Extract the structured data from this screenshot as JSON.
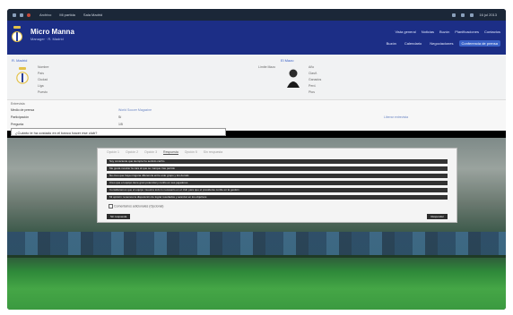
{
  "topbar": {
    "menu": [
      "Archivo",
      "Mi partida",
      "Sala Madrid"
    ],
    "date": "16 jul 2013"
  },
  "header": {
    "club_name": "Micro Manna",
    "club_sub": "Manager · R. Madrid",
    "tabs_row1": [
      "Vista general",
      "Noticias",
      "Buzón",
      "Planificaciones",
      "Contactos"
    ],
    "tabs_row2": [
      "Buzón",
      "Calendario",
      "Negociaciones",
      "Conferencia de prensa"
    ],
    "active_tab": "Conferencia de prensa"
  },
  "left_panel": {
    "title": "R. Madrid",
    "rows": [
      "Nombre",
      "País",
      "Ciudad",
      "Liga",
      "Puesto"
    ]
  },
  "right_panel": {
    "title": "El Mazo",
    "label": "Límite Mazo",
    "rows": [
      "Año",
      "Clasif.",
      "Ganados",
      "Perd.",
      "Ptos"
    ]
  },
  "info": {
    "header": "Entrevista",
    "rows": [
      {
        "label": "Medio de prensa",
        "value": "World Soccer Magazine"
      },
      {
        "label": "Participación",
        "value": "Sí"
      },
      {
        "label": "Pregunta",
        "value": "1/5"
      }
    ],
    "link": "Liberar entrevista"
  },
  "question": "¿Cuánto le ha costado en el banco hacer ese club?",
  "dialog": {
    "tabs": [
      "Opción 1",
      "Opción 2",
      "Opción 3",
      "Respuesta",
      "Opción 5",
      "Sin respuesta"
    ],
    "selected_tab": "Respuesta",
    "answers": [
      "Soy consciente que siempre he sentido cariño",
      "Me gusta mostrar la cara al que se marque tras partido",
      "No creo que haya ninguna diferencia entre este grupo y los demás",
      "Creo que el equipo tiene gran potencial y confío en sus jugadores",
      "Consideramos que el equipo muestra todo lo necesario en el club para que el presidente confie en la gestión",
      "Mi opinión: tenemos la disposición de lograr resultados y avanzar en los objetivos"
    ],
    "checkbox_label": "Comentarios adicionales (Opcional)",
    "left_button": "Sin respuesta",
    "right_button": "Responder"
  }
}
